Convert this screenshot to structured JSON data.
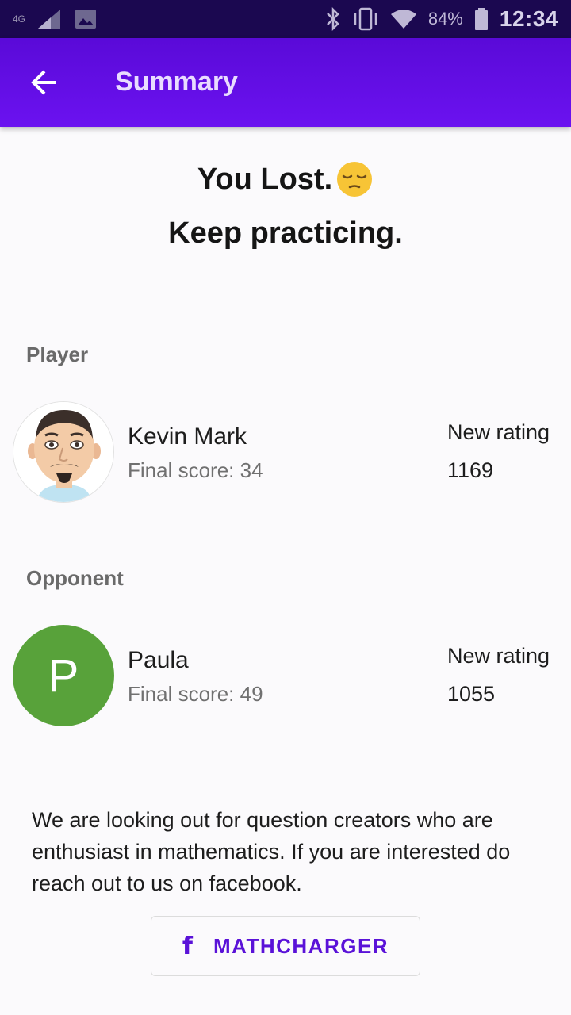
{
  "status_bar": {
    "network": "4G",
    "battery_percent": "84%",
    "time": "12:34"
  },
  "app_bar": {
    "title": "Summary",
    "back_icon": "arrow-left-icon"
  },
  "result": {
    "headline": "You Lost.",
    "emoji": "pensive-face-emoji",
    "subline": "Keep practicing."
  },
  "player_section": {
    "label": "Player",
    "name": "Kevin Mark",
    "final_score": "Final score: 34",
    "rating_label": "New rating",
    "rating_value": "1169"
  },
  "opponent_section": {
    "label": "Opponent",
    "initial": "P",
    "avatar_color": "#58a23a",
    "name": "Paula",
    "final_score": "Final score: 49",
    "rating_label": "New rating",
    "rating_value": "1055"
  },
  "promo": {
    "text": "We are looking out for question creators who are enthusiast in mathematics. If you are interested do reach out to us on facebook."
  },
  "facebook_button": {
    "icon": "facebook-icon",
    "label": "MATHCHARGER"
  },
  "colors": {
    "app_bar": "#6b12f0",
    "accent": "#5a12d8",
    "status_bar": "#1b0850"
  }
}
